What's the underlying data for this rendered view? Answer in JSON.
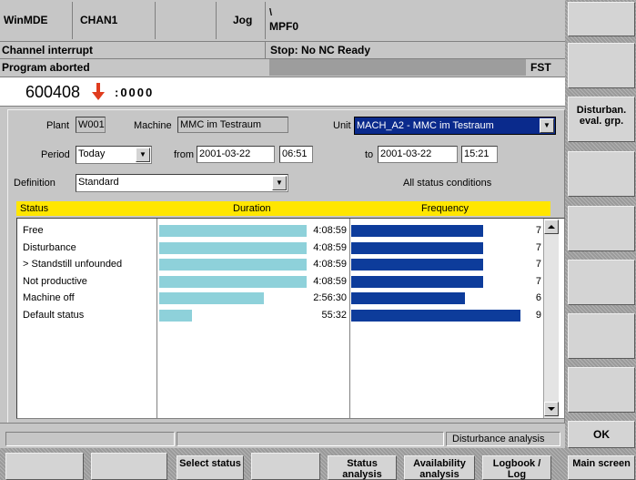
{
  "header": {
    "app": "WinMDE",
    "channel": "CHAN1",
    "mode": "Jog",
    "path": "\\",
    "program": "MPF0",
    "channel_status": "Channel interrupt",
    "stop_message": "Stop: No NC Ready",
    "program_status": "Program aborted",
    "fst": "FST",
    "alarm_number": "600408",
    "alarm_code": ":0000"
  },
  "filters": {
    "plant_label": "Plant",
    "plant_value": "W001",
    "machine_label": "Machine",
    "machine_value": "MMC im Testraum",
    "unit_label": "Unit",
    "unit_value": "MACH_A2 - MMC im Testraum",
    "period_label": "Period",
    "period_value": "Today",
    "from_label": "from",
    "from_date": "2001-03-22",
    "from_time": "06:51",
    "to_label": "to",
    "to_date": "2001-03-22",
    "to_time": "15:21",
    "definition_label": "Definition",
    "definition_value": "Standard",
    "all_status_text": "All status conditions"
  },
  "table": {
    "headers": {
      "status": "Status",
      "duration": "Duration",
      "frequency": "Frequency"
    },
    "rows": [
      {
        "status": "Free",
        "duration": "4:08:59",
        "duration_fraction": 0.99,
        "frequency": "7",
        "frequency_fraction": 0.78
      },
      {
        "status": "Disturbance",
        "duration": "4:08:59",
        "duration_fraction": 0.99,
        "frequency": "7",
        "frequency_fraction": 0.78
      },
      {
        "status": "> Standstill unfounded",
        "duration": "4:08:59",
        "duration_fraction": 0.99,
        "frequency": "7",
        "frequency_fraction": 0.78
      },
      {
        "status": "Not productive",
        "duration": "4:08:59",
        "duration_fraction": 0.99,
        "frequency": "7",
        "frequency_fraction": 0.78
      },
      {
        "status": "Machine off",
        "duration": "2:56:30",
        "duration_fraction": 0.7,
        "frequency": "6",
        "frequency_fraction": 0.67
      },
      {
        "status": "Default status",
        "duration": "55:32",
        "duration_fraction": 0.22,
        "frequency": "9",
        "frequency_fraction": 1.0
      }
    ]
  },
  "statusbar": {
    "right_text": "Disturbance analysis"
  },
  "softkeys_right": {
    "k3": "Disturban. eval. grp.",
    "ok": "OK"
  },
  "softkeys_bottom": {
    "select_status": "Select status",
    "status_analysis": "Status analysis",
    "availability_analysis": "Availability analysis",
    "logbook_log": "Logbook / Log",
    "main_screen": "Main screen"
  },
  "colors": {
    "highlight_yellow": "#ffe600",
    "duration_bar": "#8ed1da",
    "frequency_bar": "#0d3c9b",
    "selected_field": "#0a2a8c",
    "alarm_arrow": "#e03c1e"
  }
}
